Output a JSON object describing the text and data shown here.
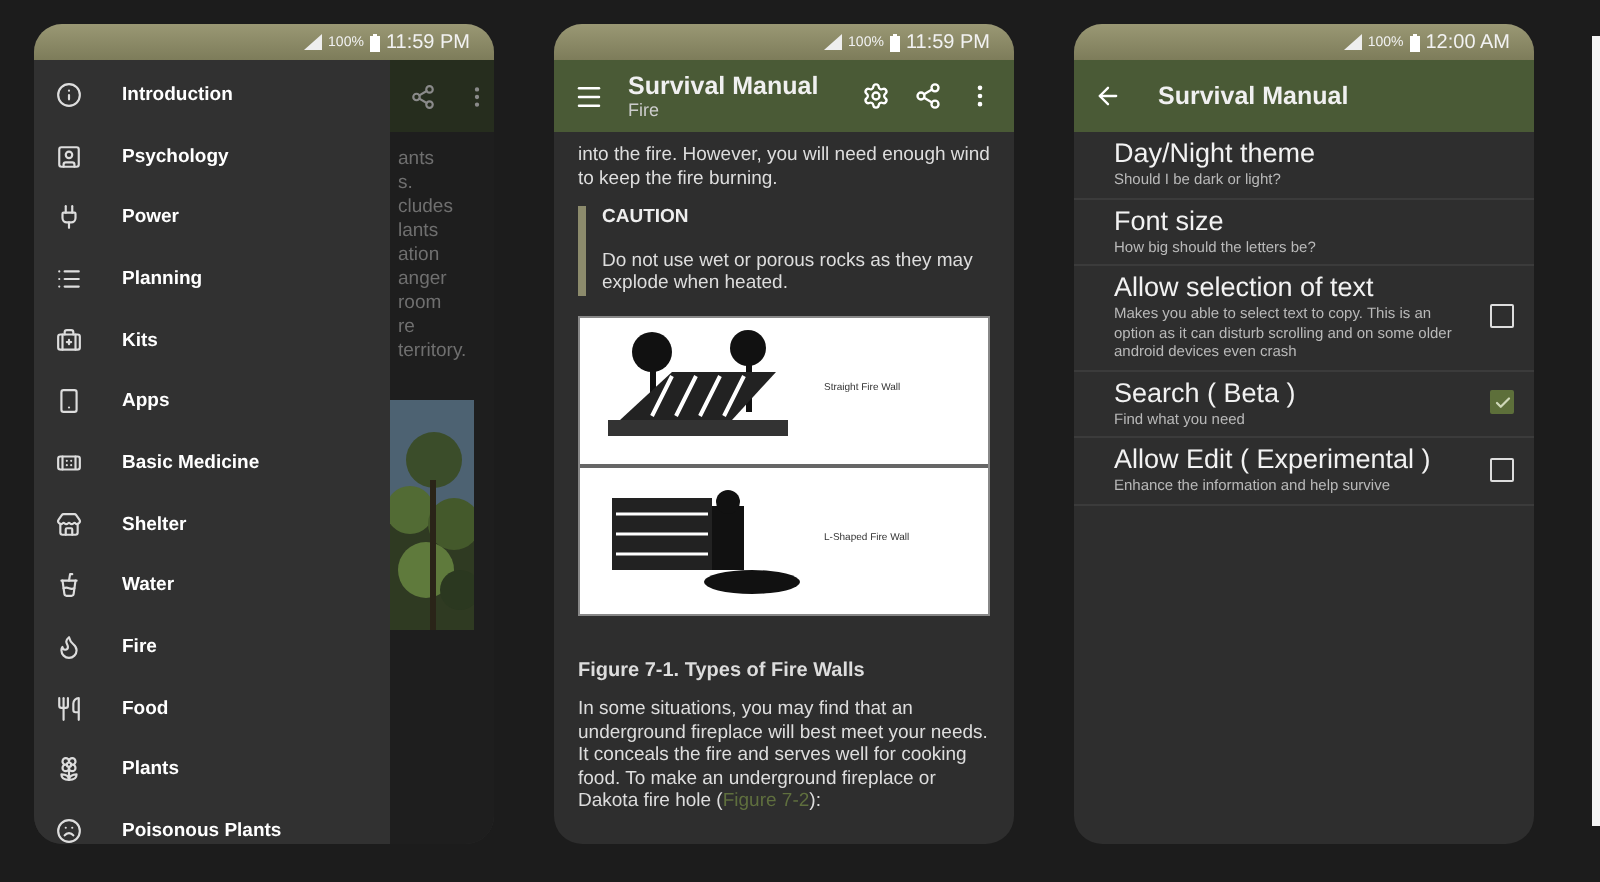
{
  "phones": [
    {
      "kind": "drawer",
      "status": {
        "battery": "100%",
        "time": "11:59 PM"
      },
      "drawer_items": [
        {
          "label": "Introduction"
        },
        {
          "label": "Psychology"
        },
        {
          "label": "Power"
        },
        {
          "label": "Planning"
        },
        {
          "label": "Kits"
        },
        {
          "label": "Apps"
        },
        {
          "label": "Basic Medicine"
        },
        {
          "label": "Shelter"
        },
        {
          "label": "Water"
        },
        {
          "label": "Fire"
        },
        {
          "label": "Food"
        },
        {
          "label": "Plants"
        },
        {
          "label": "Poisonous Plants"
        }
      ],
      "background_text": [
        "ants",
        "s.",
        "cludes",
        "lants",
        "ation",
        "anger",
        "room",
        "re",
        "territory."
      ]
    },
    {
      "kind": "article",
      "status": {
        "battery": "100%",
        "time": "11:59 PM"
      },
      "toolbar": {
        "title": "Survival Manual",
        "subtitle": "Fire"
      },
      "intro": "into the fire. However, you will need enough wind to keep the fire burning.",
      "caution": {
        "heading": "CAUTION",
        "text": "Do not use wet or porous rocks as they may explode when heated."
      },
      "figure_labels": [
        "Straight Fire Wall",
        "L-Shaped Fire Wall"
      ],
      "caption": "Figure 7-1. Types of Fire Walls",
      "paragraph": "In some situations, you may find that an underground fireplace will best meet your needs. It conceals the fire and serves well for cooking food. To make an underground fireplace or Dakota fire hole (",
      "link": "Figure 7-2",
      "paragraph_end": "):"
    },
    {
      "kind": "settings",
      "status": {
        "battery": "100%",
        "time": "12:00 AM"
      },
      "toolbar": {
        "title": "Survival Manual"
      },
      "settings": [
        {
          "title": "Day/Night theme",
          "summary": "Should I be dark or light?",
          "kind": "plain"
        },
        {
          "title": "Font size",
          "summary": "How big should the letters be?",
          "kind": "plain"
        },
        {
          "title": "Allow selection of text",
          "summary": "Makes you able to select text to copy. This is an option as it can disturb scrolling and on some older android devices even crash",
          "kind": "checkbox",
          "checked": false
        },
        {
          "title": "Search ( Beta )",
          "summary": "Find what you need",
          "kind": "checkbox",
          "checked": true
        },
        {
          "title": "Allow Edit ( Experimental )",
          "summary": "Enhance the information and help survive",
          "kind": "checkbox",
          "checked": false
        }
      ]
    }
  ]
}
